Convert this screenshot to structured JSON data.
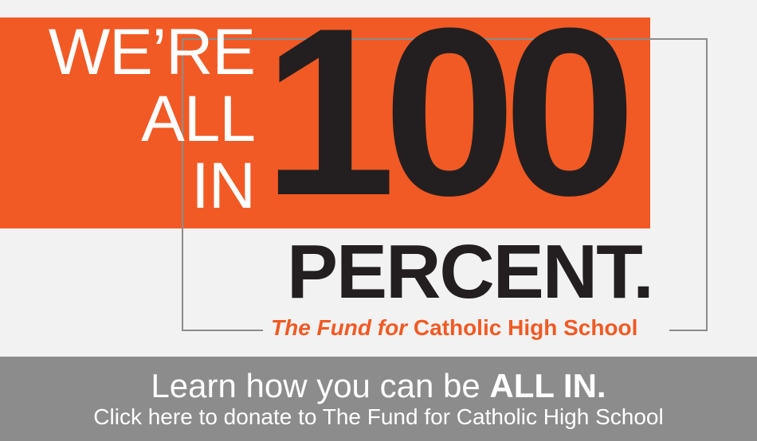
{
  "banner": {
    "headline_lines": [
      "WE’RE",
      "ALL",
      "IN"
    ],
    "big_number": "100",
    "percent_word": "PERCENT.",
    "fund_prefix": "The Fund for",
    "fund_name": "Catholic High School"
  },
  "footer": {
    "learn_text": "Learn how you can be",
    "learn_emphasis": "ALL IN.",
    "cta_text": "Click here to donate to The Fund for Catholic High School"
  },
  "colors": {
    "accent": "#f15a24",
    "dark": "#231f20",
    "footer_bg": "#8d8c8c",
    "frame": "#8c8c8c"
  }
}
